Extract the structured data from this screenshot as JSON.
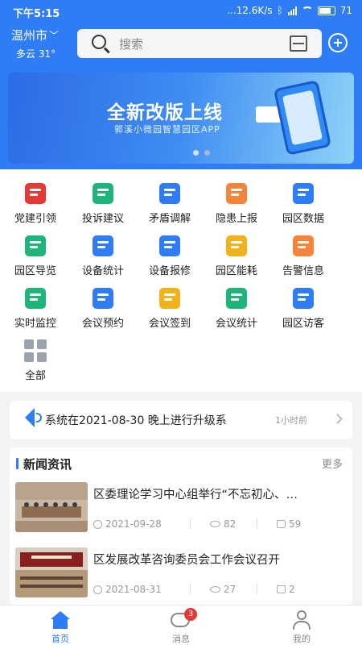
{
  "status_bar": {
    "time": "下午5:15",
    "network_speed": "...12.6K/s",
    "battery": "71"
  },
  "header": {
    "city": "温州市",
    "weather": "多云 31°",
    "search_placeholder": "搜索"
  },
  "banner": {
    "title_part1": "全新",
    "title_part2": "改版上线",
    "subtitle": "郭溪小微园智慧园区APP",
    "page_count": 2,
    "active_page": 1
  },
  "grid": {
    "items": [
      {
        "label": "党建引领",
        "icon": "party-flag-icon",
        "color": "#e53935"
      },
      {
        "label": "投诉建议",
        "icon": "mail-icon",
        "color": "#1fb57a"
      },
      {
        "label": "矛盾调解",
        "icon": "people-icon",
        "color": "#2f7df6"
      },
      {
        "label": "隐患上报",
        "icon": "warning-icon",
        "color": "#f5853b"
      },
      {
        "label": "园区数据",
        "icon": "atom-icon",
        "color": "#2f7df6"
      },
      {
        "label": "园区导览",
        "icon": "map-pin-icon",
        "color": "#1fb57a"
      },
      {
        "label": "设备统计",
        "icon": "monitor-chart-icon",
        "color": "#2f7df6"
      },
      {
        "label": "设备报修",
        "icon": "gear-wrench-icon",
        "color": "#2f7df6"
      },
      {
        "label": "园区能耗",
        "icon": "energy-cycle-icon",
        "color": "#f2b21c"
      },
      {
        "label": "告警信息",
        "icon": "alarm-light-icon",
        "color": "#f5853b"
      },
      {
        "label": "实时监控",
        "icon": "camera-icon",
        "color": "#1fb57a"
      },
      {
        "label": "会议预约",
        "icon": "calendar-clock-icon",
        "color": "#2f7df6"
      },
      {
        "label": "会议签到",
        "icon": "feather-pen-icon",
        "color": "#f2b21c"
      },
      {
        "label": "会议统计",
        "icon": "board-chart-icon",
        "color": "#1fb57a"
      },
      {
        "label": "园区访客",
        "icon": "visitor-card-icon",
        "color": "#2f7df6"
      },
      {
        "label": "全部",
        "icon": "all-grid-icon",
        "color": "#9aa3ad"
      }
    ]
  },
  "notice": {
    "text": "系统在2021-08-30 晚上进行升级系",
    "time": "1小时前"
  },
  "news": {
    "title": "新闻资讯",
    "more": "更多",
    "articles": [
      {
        "title": "区委理论学习中心组举行“不忘初心、…",
        "date": "2021-09-28",
        "views": "82",
        "likes": "59"
      },
      {
        "title": "区发展改革咨询委员会工作会议召开",
        "date": "2021-08-31",
        "views": "27",
        "likes": "2"
      }
    ]
  },
  "tabbar": {
    "tabs": [
      {
        "label": "首页",
        "active": true
      },
      {
        "label": "消息",
        "badge": "3"
      },
      {
        "label": "我的"
      }
    ]
  }
}
